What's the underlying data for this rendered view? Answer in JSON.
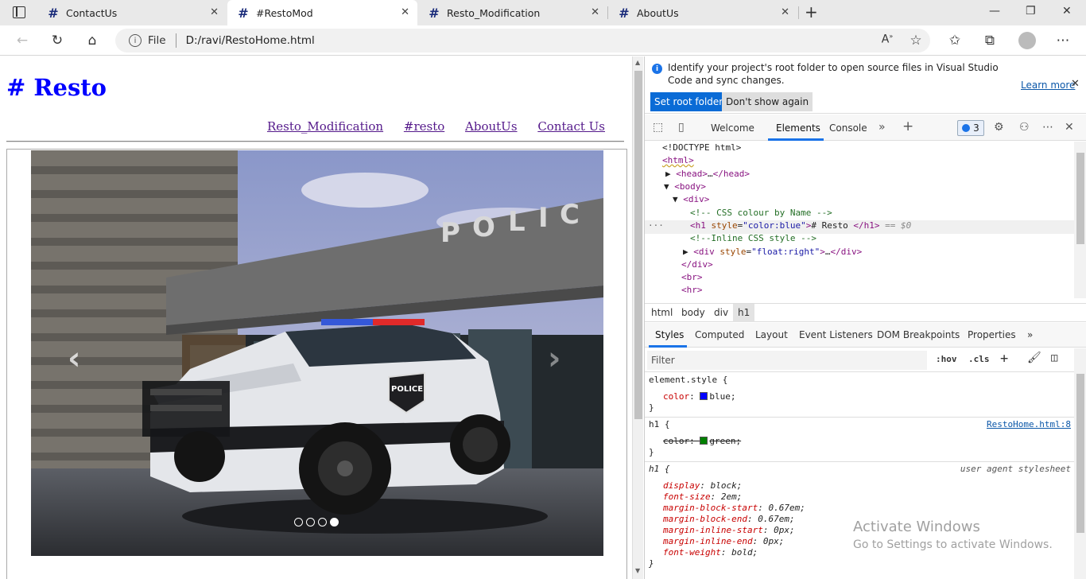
{
  "tabs": [
    {
      "title": "ContactUs",
      "active": false
    },
    {
      "title": "#RestoMod",
      "active": true
    },
    {
      "title": "Resto_Modification",
      "active": false
    },
    {
      "title": "AboutUs",
      "active": false
    }
  ],
  "tab_favicon": "#",
  "address": {
    "protocol_label": "File",
    "url": "D:/ravi/RestoHome.html"
  },
  "page": {
    "heading": "# Resto",
    "links": [
      "Resto_Modification",
      "#resto",
      "AboutUs",
      "Contact Us"
    ],
    "carousel": {
      "slide_count": 4,
      "active_index": 3,
      "prev_icon": "chevron-left-icon",
      "next_icon": "chevron-right-icon"
    }
  },
  "devtools": {
    "infobar": {
      "message": "Identify your project's root folder to open source files in Visual Studio Code and sync changes.",
      "learn_more": "Learn more",
      "set_root": "Set root folder",
      "dont_show": "Don't show again"
    },
    "tabs": [
      "Welcome",
      "Elements",
      "Console"
    ],
    "active_tab": "Elements",
    "issues_count": "3",
    "dom": {
      "doctype": "<!DOCTYPE html>",
      "html_open": "<html>",
      "head_tag_open": "<head>",
      "head_ellipsis": "…",
      "head_tag_close": "</head>",
      "body_open": "<body>",
      "div_open": "<div>",
      "comment1": "<!-- CSS colour by Name -->",
      "h1_tag_open": "<h1",
      "h1_attr_name": "style",
      "h1_attr_value": "\"color:blue\"",
      "h1_tag_close_bracket": ">",
      "h1_text": "# Resto ",
      "h1_tag_end": "</h1>",
      "h1_suffix": " == $0",
      "comment2": "<!--Inline CSS style -->",
      "div2_tag_open": "<div",
      "div2_attr_name": "style",
      "div2_attr_value": "\"float:right\"",
      "div2_tag_close_bracket": ">",
      "div2_ellipsis": "…",
      "div2_tag_end": "</div>",
      "div_close": "</div>",
      "br": "<br>",
      "hr": "<hr>",
      "dots": "···"
    },
    "breadcrumbs": [
      "html",
      "body",
      "div",
      "h1"
    ],
    "styles_tabs": [
      "Styles",
      "Computed",
      "Layout",
      "Event Listeners",
      "DOM Breakpoints",
      "Properties"
    ],
    "filter_placeholder": "Filter",
    "filter_opts": [
      ":hov",
      ".cls"
    ],
    "rules": {
      "element_style_selector": "element.style {",
      "element_style_prop": "color",
      "element_style_value": "blue;",
      "h1_author_selector": "h1 {",
      "h1_author_source": "RestoHome.html:8",
      "h1_author_prop": "color",
      "h1_author_value": "green;",
      "h1_ua_selector": "h1 {",
      "h1_ua_source": "user agent stylesheet",
      "h1_ua_props": [
        {
          "name": "display",
          "value": "block;"
        },
        {
          "name": "font-size",
          "value": "2em;"
        },
        {
          "name": "margin-block-start",
          "value": "0.67em;"
        },
        {
          "name": "margin-block-end",
          "value": "0.67em;"
        },
        {
          "name": "margin-inline-start",
          "value": "0px;"
        },
        {
          "name": "margin-inline-end",
          "value": "0px;"
        },
        {
          "name": "font-weight",
          "value": "bold;"
        }
      ],
      "close_brace": "}",
      "colon": ": "
    },
    "colors": {
      "blue": "#0000ff",
      "green": "#008000"
    }
  },
  "watermark": {
    "line1": "Activate Windows",
    "line2": "Go to Settings to activate Windows."
  }
}
